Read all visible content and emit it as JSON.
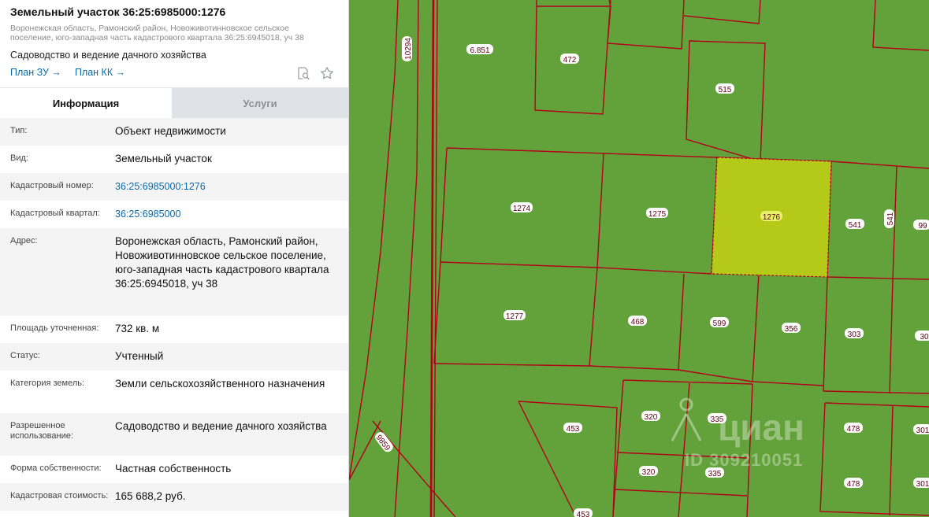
{
  "header": {
    "title": "Земельный участок 36:25:6985000:1276",
    "address": "Воронежская область, Рамонский район, Новоживотинновское сельское поселение, юго-западная часть кадастрового квартала 36:25:6945018, уч 38",
    "purpose": "Садоводство и ведение дачного хозяйства",
    "link_plan_zu": "План ЗУ →",
    "link_plan_kk": "План КК →",
    "icon_search": "search-document-icon",
    "icon_favorite": "star-icon"
  },
  "tabs": [
    {
      "label": "Информация",
      "active": true
    },
    {
      "label": "Услуги",
      "active": false
    }
  ],
  "info": [
    {
      "label": "Тип:",
      "value": "Объект недвижимости"
    },
    {
      "label": "Вид:",
      "value": "Земельный участок"
    },
    {
      "label": "Кадастровый номер:",
      "value": "36:25:6985000:1276"
    },
    {
      "label": "Кадастровый квартал:",
      "value": "36:25:6985000"
    },
    {
      "label": "Адрес:",
      "value": "Воронежская область, Рамонский район, Новоживотинновское сельское поселение, юго-западная часть кадастрового квартала 36:25:6945018, уч 38"
    },
    {
      "label": "Площадь уточненная:",
      "value": "732 кв. м"
    },
    {
      "label": "Статус:",
      "value": "Учтенный"
    },
    {
      "label": "Категория земель:",
      "value": "Земли сельскохозяйственного назначения"
    },
    {
      "label": "Разрешенное использование:",
      "value": "Садоводство и ведение дачного хозяйства"
    },
    {
      "label": "Форма собственности:",
      "value": "Частная собственность"
    },
    {
      "label": "Кадастровая стоимость:",
      "value": "165 688,2 руб."
    }
  ],
  "map": {
    "background_color": "#63a23a",
    "highlight_color": "#b5c918",
    "border_color": "#b3001b",
    "selected_parcel": "1276",
    "parcel_labels": [
      "1274",
      "1275",
      "1276",
      "541",
      "99",
      "1277",
      "468",
      "599",
      "356",
      "303",
      "30",
      "472",
      "515",
      "453",
      "320",
      "335",
      "320",
      "335",
      "478",
      "301",
      "478",
      "301",
      "453",
      "6.851",
      "10294",
      "9859",
      "541"
    ],
    "watermark_brand": "циан",
    "watermark_id": "ID 309210051"
  }
}
